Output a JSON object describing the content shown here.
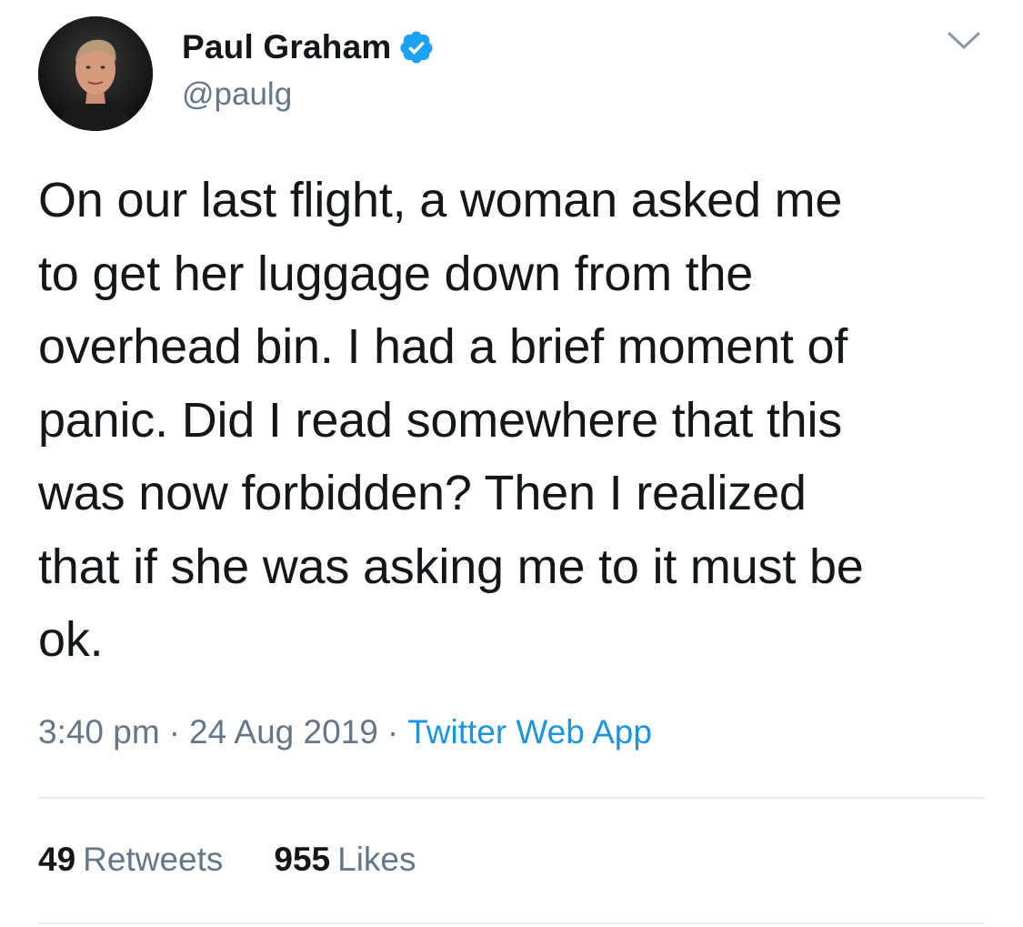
{
  "author": {
    "display_name": "Paul Graham",
    "handle": "@paulg",
    "verified": true,
    "verified_icon": "verified-badge-icon",
    "verified_color": "#1da1f2"
  },
  "tweet": {
    "text": "On our last flight, a woman asked me\nto get her luggage down from the\noverhead bin. I had a brief moment of\npanic. Did I read somewhere that this\nwas now forbidden? Then I realized\nthat if she was asking me to it must be\nok."
  },
  "meta": {
    "time": "3:40 pm",
    "separator": "·",
    "date": "24 Aug 2019",
    "source": "Twitter Web App"
  },
  "stats": {
    "retweets_count": "49",
    "retweets_label": "Retweets",
    "likes_count": "955",
    "likes_label": "Likes"
  },
  "menu": {
    "icon": "chevron-down-icon"
  },
  "colors": {
    "text": "#14171a",
    "secondary": "#657786",
    "link": "#1b95e0",
    "divider": "#e6ecf0"
  }
}
